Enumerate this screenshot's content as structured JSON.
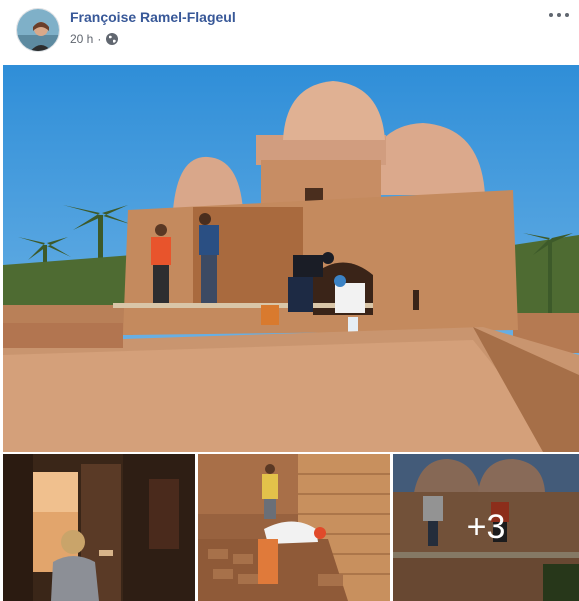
{
  "post": {
    "author": "Françoise Ramel-Flageul",
    "timestamp": "20 h",
    "separator": "·",
    "privacy_icon": "globe-icon",
    "menu_icon": "more-options-icon"
  },
  "gallery": {
    "more_count_label": "+3",
    "photos": [
      "main-photo",
      "thumb-photo-1",
      "thumb-photo-2",
      "thumb-photo-3"
    ]
  },
  "colors": {
    "author_link": "#385898",
    "meta_text": "#616770",
    "sky": "#3b95d9",
    "adobe": "#c98c60"
  }
}
